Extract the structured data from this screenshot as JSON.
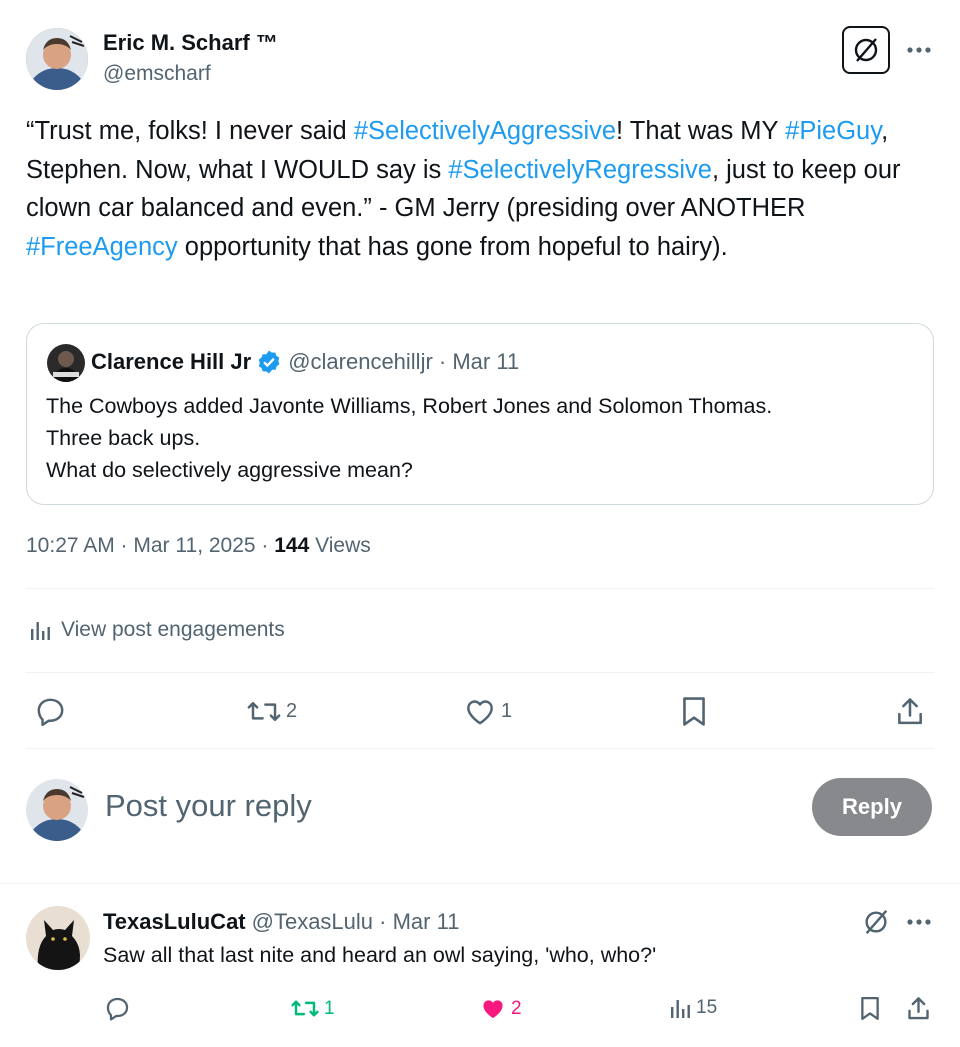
{
  "post": {
    "author_name": "Eric M. Scharf ™",
    "author_handle": "@emscharf",
    "text": [
      {
        "t": "“Trust me, folks! I never said ",
        "link": false
      },
      {
        "t": "#SelectivelyAggressive",
        "link": true
      },
      {
        "t": "! That was MY ",
        "link": false
      },
      {
        "t": "#PieGuy",
        "link": true
      },
      {
        "t": ", Stephen. Now, what I WOULD say is ",
        "link": false
      },
      {
        "t": "#SelectivelyRegressive",
        "link": true
      },
      {
        "t": ", just to keep our clown car balanced and even.” - GM Jerry (presiding over ANOTHER ",
        "link": false
      },
      {
        "t": "#FreeAgency",
        "link": true
      },
      {
        "t": " opportunity that has gone from hopeful to hairy).",
        "link": false
      }
    ],
    "time": "10:27 AM · Mar 11, 2025 · ",
    "views_count": "144",
    "views_label": " Views",
    "engagements_label": "View post engagements",
    "actions": {
      "replies": "",
      "reposts": "2",
      "likes": "1"
    }
  },
  "quote": {
    "author_name": "Clarence Hill Jr",
    "author_handle": "@clarencehilljr",
    "sep": " · ",
    "date": "Mar 11",
    "lines": [
      "The Cowboys added Javonte Williams, Robert Jones and Solomon Thomas.",
      "Three back ups.",
      "What do selectively aggressive mean?"
    ]
  },
  "reply_box": {
    "placeholder": "Post your reply",
    "button": "Reply"
  },
  "reply": {
    "author_name": "TexasLuluCat",
    "author_handle": "@TexasLulu",
    "sep": " · ",
    "date": "Mar 11",
    "text": "Saw all that last nite and heard an owl saying, 'who, who?'",
    "reposts": "1",
    "likes": "2",
    "views": "15"
  },
  "colors": {
    "link": "#1d9bf0",
    "muted": "#536471",
    "repost_active": "#00ba7c",
    "like_active": "#f91880",
    "reply_button": "#87898c"
  }
}
